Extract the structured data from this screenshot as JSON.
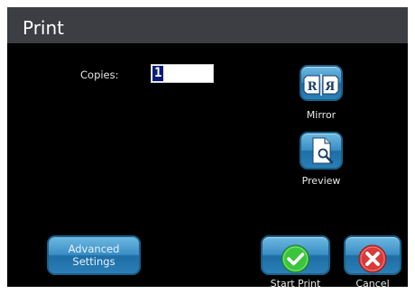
{
  "window": {
    "title": "Print"
  },
  "copies": {
    "label": "Copies:",
    "value": "1"
  },
  "buttons": {
    "mirror_label": "Mirror",
    "preview_label": "Preview",
    "advanced_label": "Advanced\nSettings",
    "start_print_label": "Start Print",
    "cancel_label": "Cancel"
  },
  "icons": {
    "mirror": "mirror-icon",
    "preview": "preview-magnifier-icon",
    "start_print": "checkmark-icon",
    "cancel": "x-icon"
  },
  "colors": {
    "background": "#000000",
    "header": "#3c3e44",
    "button_blue": "#3a8ec4",
    "start_green": "#3cc43c",
    "cancel_red": "#d83a3a",
    "selection": "#0a1a7a"
  }
}
